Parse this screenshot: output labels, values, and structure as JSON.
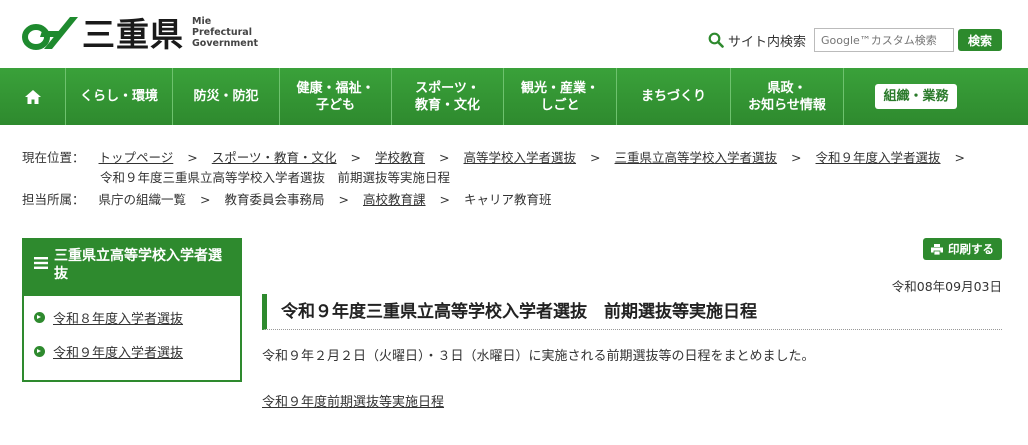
{
  "header": {
    "logo_kanji": "三重県",
    "logo_en_1": "Mie",
    "logo_en_2": "Prefectural",
    "logo_en_3": "Government",
    "search_label": "サイト内検索",
    "search_placeholder": "Google™カスタム検索",
    "search_button": "検索"
  },
  "nav": {
    "items": [
      {
        "label": "くらし・環境"
      },
      {
        "label": "防災・防犯"
      },
      {
        "label": "健康・福祉・\n子ども"
      },
      {
        "label": "スポーツ・\n教育・文化"
      },
      {
        "label": "観光・産業・\nしごと"
      },
      {
        "label": "まちづくり"
      },
      {
        "label": "県政・\nお知らせ情報"
      },
      {
        "label": "組織・業務"
      }
    ]
  },
  "breadcrumb": {
    "location_label": "現在位置：",
    "items": [
      "トップページ",
      "スポーツ・教育・文化",
      "学校教育",
      "高等学校入学者選抜",
      "三重県立高等学校入学者選抜",
      "令和９年度入学者選抜"
    ],
    "current": "令和９年度三重県立高等学校入学者選抜　前期選抜等実施日程",
    "dept_label": "担当所属：",
    "dept_items": [
      "県庁の組織一覧",
      "教育委員会事務局",
      "高校教育課",
      "キャリア教育班"
    ],
    "separator": ">"
  },
  "sidebar": {
    "title": "三重県立高等学校入学者選抜",
    "items": [
      "令和８年度入学者選抜",
      "令和９年度入学者選抜"
    ]
  },
  "main": {
    "print_label": "印刷する",
    "date": "令和08年09月03日",
    "title": "令和９年度三重県立高等学校入学者選抜　前期選抜等実施日程",
    "body": "令和９年２月２日（火曜日）・３日（水曜日）に実施される前期選抜等の日程をまとめました。",
    "link": "令和９年度前期選抜等実施日程"
  },
  "colors": {
    "brand_green": "#2e8a2e"
  }
}
